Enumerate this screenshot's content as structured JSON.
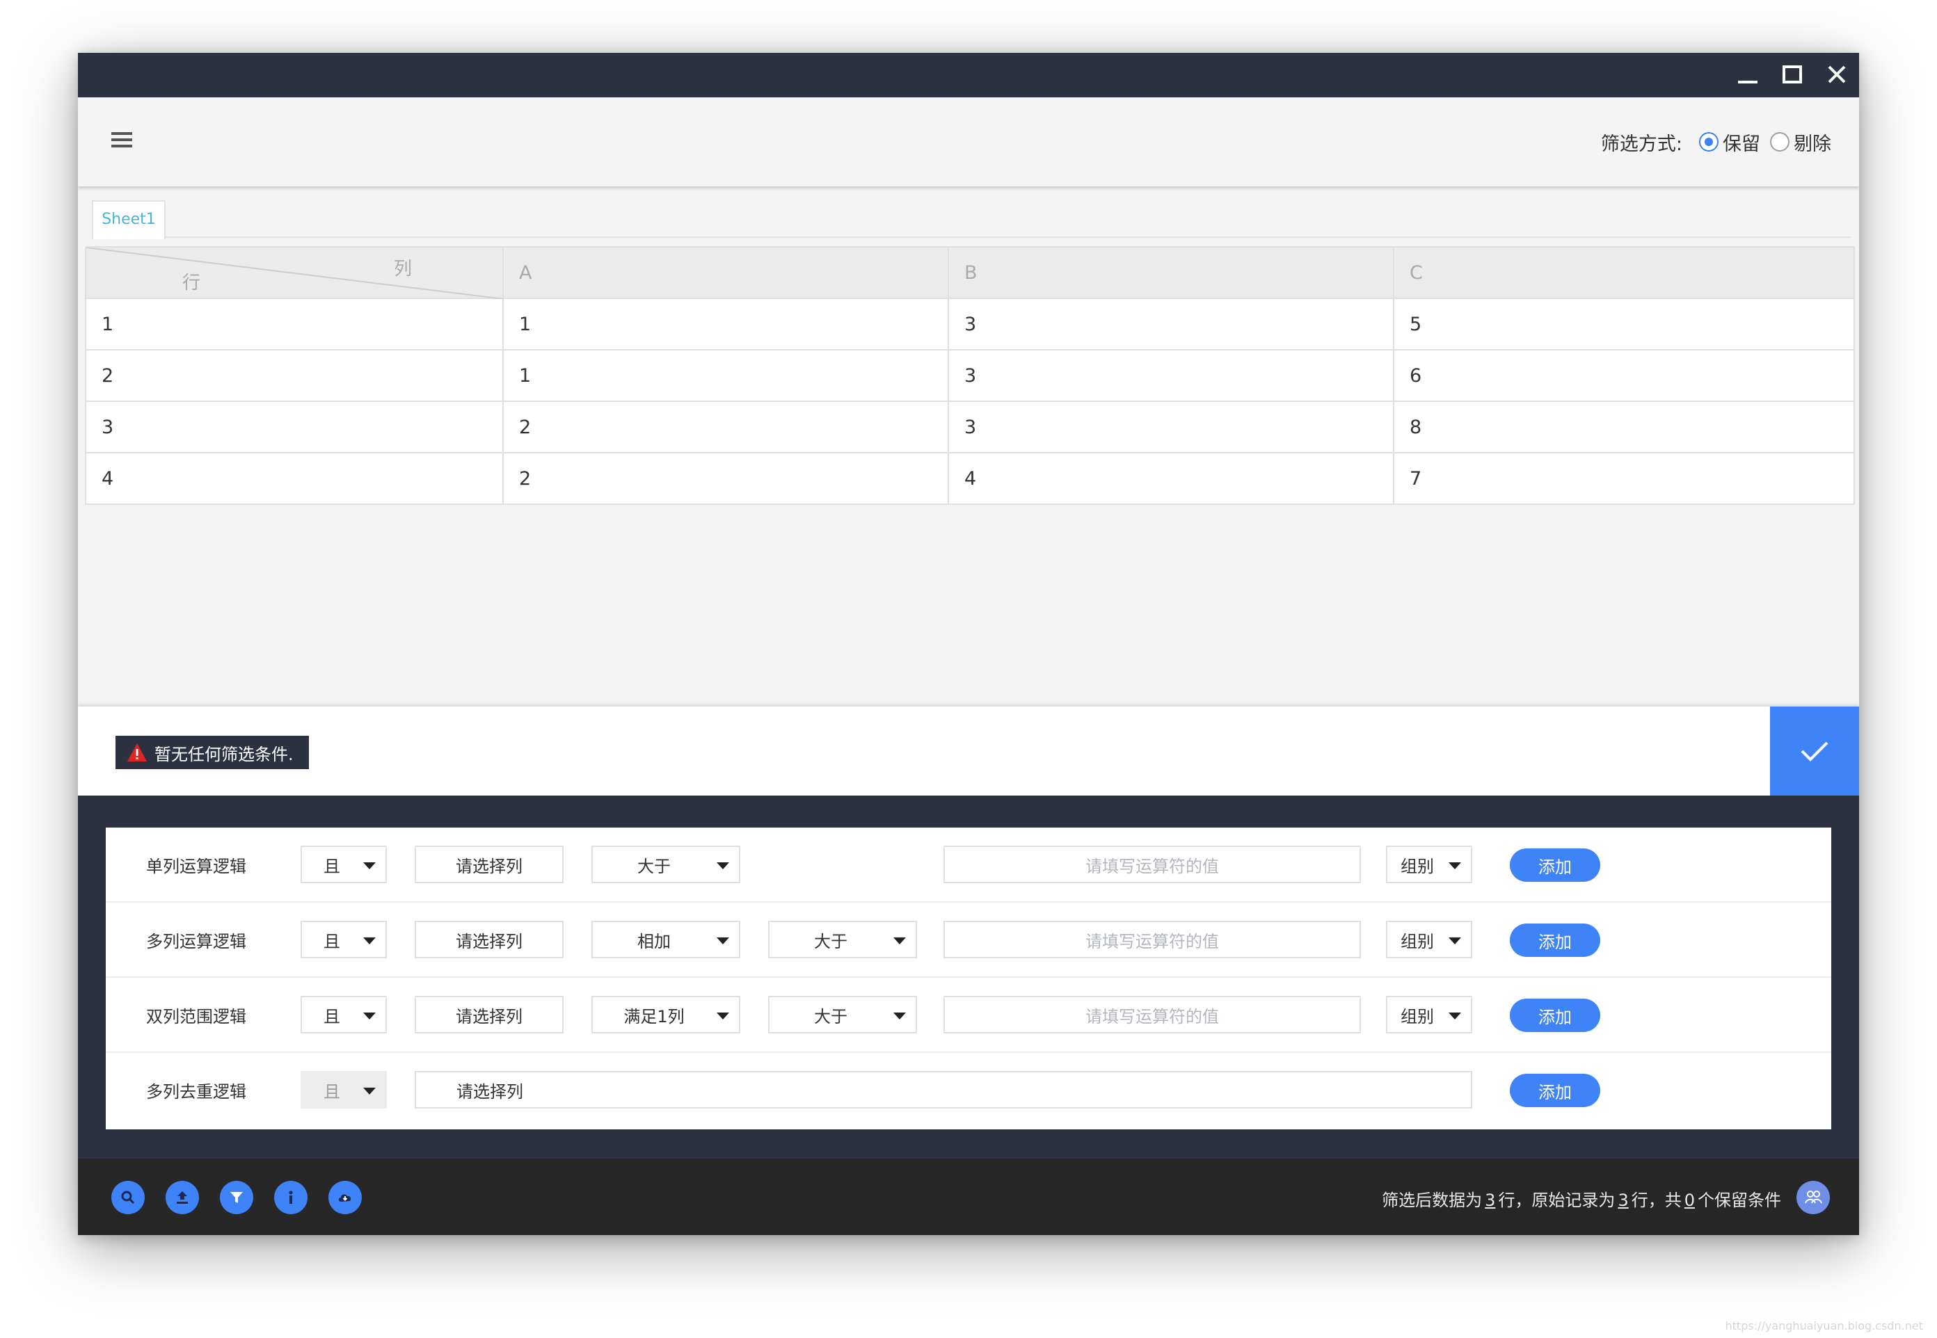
{
  "toolbar": {
    "filter_mode_label": "筛选方式:",
    "options": [
      {
        "label": "保留",
        "selected": true
      },
      {
        "label": "剔除",
        "selected": false
      }
    ]
  },
  "sheet": {
    "tab": "Sheet1",
    "corner_col": "列",
    "corner_row": "行",
    "columns": [
      "A",
      "B",
      "C"
    ],
    "rows": [
      [
        "1",
        "1",
        "3",
        "5"
      ],
      [
        "2",
        "1",
        "3",
        "6"
      ],
      [
        "3",
        "2",
        "3",
        "8"
      ],
      [
        "4",
        "2",
        "4",
        "7"
      ]
    ]
  },
  "status": {
    "warning": "暂无任何筛选条件."
  },
  "conditions": [
    {
      "label": "单列运算逻辑",
      "logic": "且",
      "column": "请选择列",
      "op": "大于",
      "value_placeholder": "请填写运算符的值",
      "group": "组别",
      "add": "添加"
    },
    {
      "label": "多列运算逻辑",
      "logic": "且",
      "column": "请选择列",
      "op": "相加",
      "op2": "大于",
      "value_placeholder": "请填写运算符的值",
      "group": "组别",
      "add": "添加"
    },
    {
      "label": "双列范围逻辑",
      "logic": "且",
      "column": "请选择列",
      "op": "满足1列",
      "op2": "大于",
      "value_placeholder": "请填写运算符的值",
      "group": "组别",
      "add": "添加"
    },
    {
      "label": "多列去重逻辑",
      "logic": "且",
      "column": "请选择列",
      "add": "添加"
    }
  ],
  "footer": {
    "icons": [
      "search-icon",
      "upload-icon",
      "filter-icon",
      "info-icon",
      "cloud-download-icon"
    ],
    "summary_prefix": "筛选后数据为",
    "filtered_rows": "3",
    "summary_mid1": "行，原始记录为",
    "original_rows": "3",
    "summary_mid2": "行，共",
    "kept_conditions": "0",
    "summary_suffix": "个保留条件"
  },
  "watermark": "https://yanghuaiyuan.blog.csdn.net",
  "colors": {
    "accent": "#3f83f8",
    "dark": "#2d3243",
    "warning": "#e02424"
  }
}
